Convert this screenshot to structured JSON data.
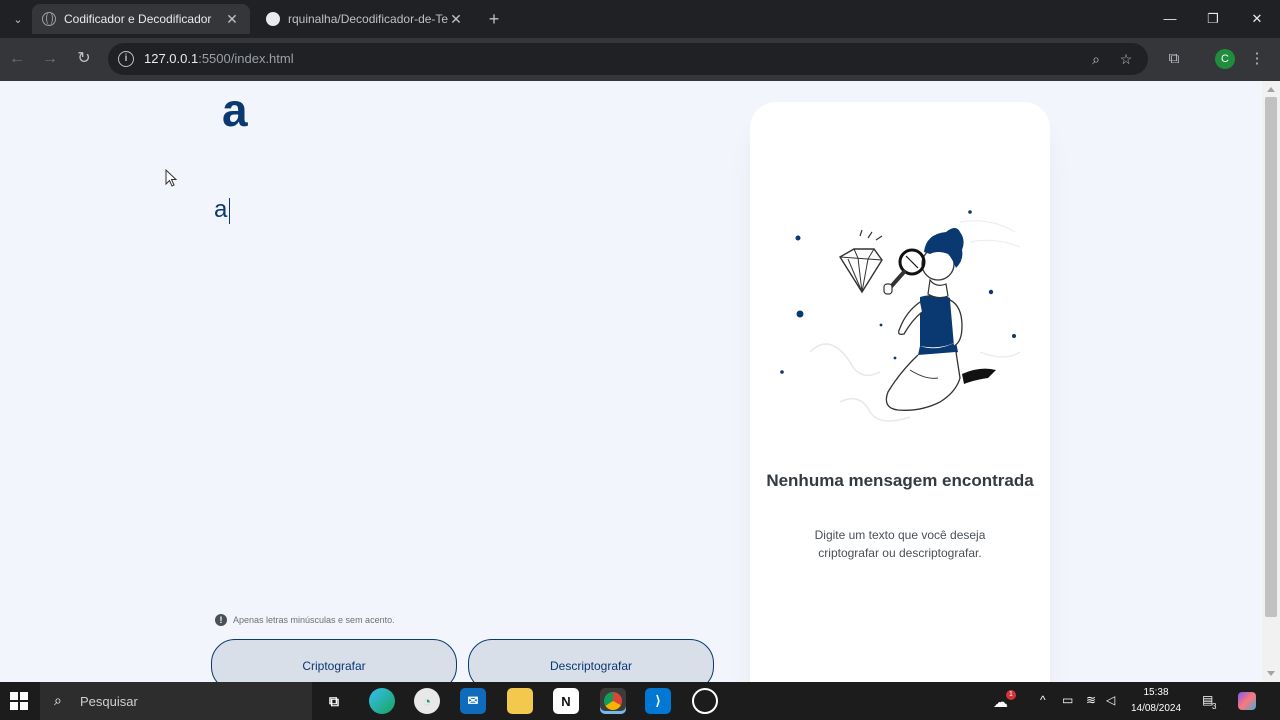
{
  "browser": {
    "tabs": [
      {
        "title": "Codificador e Decodificador",
        "active": true
      },
      {
        "title": "rquinalha/Decodificador-de-Te",
        "active": false
      }
    ],
    "new_tab": "+",
    "url_host": "127.0.0.1",
    "url_rest": ":5500/index.html",
    "profile_initial": "C",
    "window_controls": {
      "minimize": "—",
      "restore": "❐",
      "close": "✕"
    }
  },
  "page": {
    "logo": "a",
    "input_text": "a",
    "hint": "Apenas letras minúsculas e sem acento.",
    "buttons": {
      "encrypt": "Criptografar",
      "decrypt": "Descriptografar"
    },
    "output_card": {
      "title": "Nenhuma mensagem encontrada",
      "subtitle": "Digite um texto que você deseja criptografar ou descriptografar."
    },
    "colors": {
      "brand": "#0a3871",
      "background": "#f3f5fc",
      "card": "#ffffff"
    }
  },
  "taskbar": {
    "search_placeholder": "Pesquisar",
    "apps": [
      "task-view",
      "edge",
      "chrome-dev",
      "mail",
      "file-explorer",
      "notion",
      "chrome",
      "vscode",
      "recorder"
    ],
    "weather_badge": "1",
    "notifications_count": "3",
    "time": "15:38",
    "date": "14/08/2024"
  }
}
